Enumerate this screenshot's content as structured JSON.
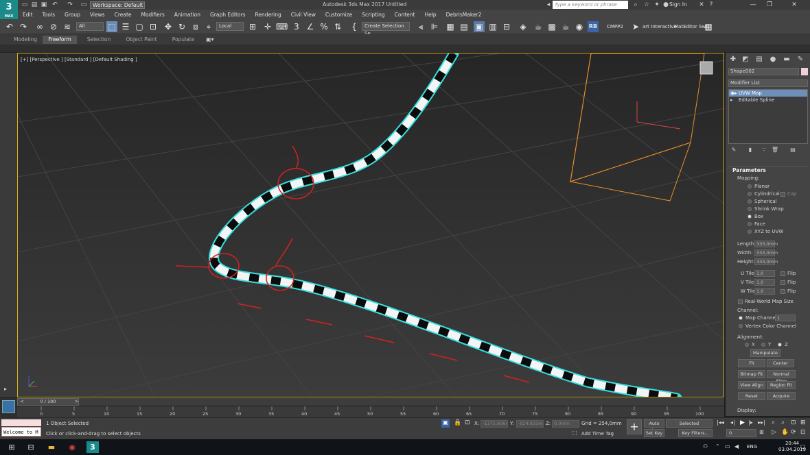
{
  "app": {
    "logo": "3",
    "logo_sub": "MAX",
    "window_title": "Autodesk 3ds Max 2017    Untitled",
    "workspace": "Workspace: Default",
    "search_placeholder": "Type a keyword or phrase",
    "sign_in": "Sign In"
  },
  "menu": [
    "Edit",
    "Tools",
    "Group",
    "Views",
    "Create",
    "Modifiers",
    "Animation",
    "Graph Editors",
    "Rendering",
    "Civil View",
    "Customize",
    "Scripting",
    "Content",
    "Help",
    "DebrisMaker2"
  ],
  "toolbar": {
    "selection_filter": "All",
    "ref_coord": "Local",
    "named_selection": "Create Selection Se",
    "cmpp2": "CMPP2",
    "interactive": "art Interactive",
    "mateditor": "MatEditor Swi",
    "rb": "RB"
  },
  "ribbon_tabs": [
    "Modeling",
    "Freeform",
    "Selection",
    "Object Paint",
    "Populate"
  ],
  "viewport": {
    "label": "[+] [Perspective ] [Standard ] [Default Shading ]"
  },
  "command_panel": {
    "object_name": "Shape002",
    "modifier_list": "Modifier List",
    "stack": [
      "UVW Map",
      "Editable Spline"
    ],
    "params_title": "Parameters",
    "mapping_label": "Mapping:",
    "mapping_options": [
      "Planar",
      "Cylindrical",
      "Spherical",
      "Shrink Wrap",
      "Box",
      "Face",
      "XYZ to UVW"
    ],
    "cap_label": "Cap",
    "mapping_selected": "Box",
    "length_label": "Length:",
    "length": "333,0mm",
    "width_label": "Width:",
    "width": "333,0mm",
    "height_label": "Height:",
    "height": "333,0mm",
    "u_tile_label": "U Tile:",
    "u_tile": "1,0",
    "v_tile_label": "V Tile:",
    "v_tile": "1,0",
    "w_tile_label": "W Tile:",
    "w_tile": "1,0",
    "flip_label": "Flip",
    "real_world": "Real-World Map Size",
    "channel_label": "Channel:",
    "map_channel_label": "Map Channel:",
    "map_channel": "1",
    "vertex_color": "Vertex Color Channel",
    "alignment_label": "Alignment:",
    "axes": [
      "X",
      "Y",
      "Z"
    ],
    "axis_selected": "Z",
    "manipulate": "Manipulate",
    "buttons": [
      "Fit",
      "Center",
      "Bitmap Fit",
      "Normal Align",
      "View Align",
      "Region Fit",
      "Reset",
      "Acquire"
    ],
    "display_label": "Display:"
  },
  "timeline": {
    "frame": "0 / 100",
    "ticks": [
      "0",
      "5",
      "10",
      "15",
      "20",
      "25",
      "30",
      "35",
      "40",
      "45",
      "50",
      "55",
      "60",
      "65",
      "70",
      "75",
      "80",
      "85",
      "90",
      "95",
      "100"
    ]
  },
  "status": {
    "maxscript": "Welcome to M",
    "selected": "1 Object Selected",
    "prompt": "Click or click-and-drag to select objects",
    "x_label": "X:",
    "x_value": "-1375,606r",
    "y_label": "Y:",
    "y_value": "-924,833m",
    "z_label": "Z:",
    "z_value": "0,0mm",
    "grid": "Grid = 254,0mm",
    "add_time_tag": "Add Time Tag",
    "auto_key": "Auto Key",
    "set_key": "Set Key",
    "key_mode": "Selected",
    "key_filters": "Key Filters...",
    "current_frame": "0"
  },
  "taskbar": {
    "lang": "ENG",
    "time": "20:44",
    "date": "03.04.2019"
  }
}
